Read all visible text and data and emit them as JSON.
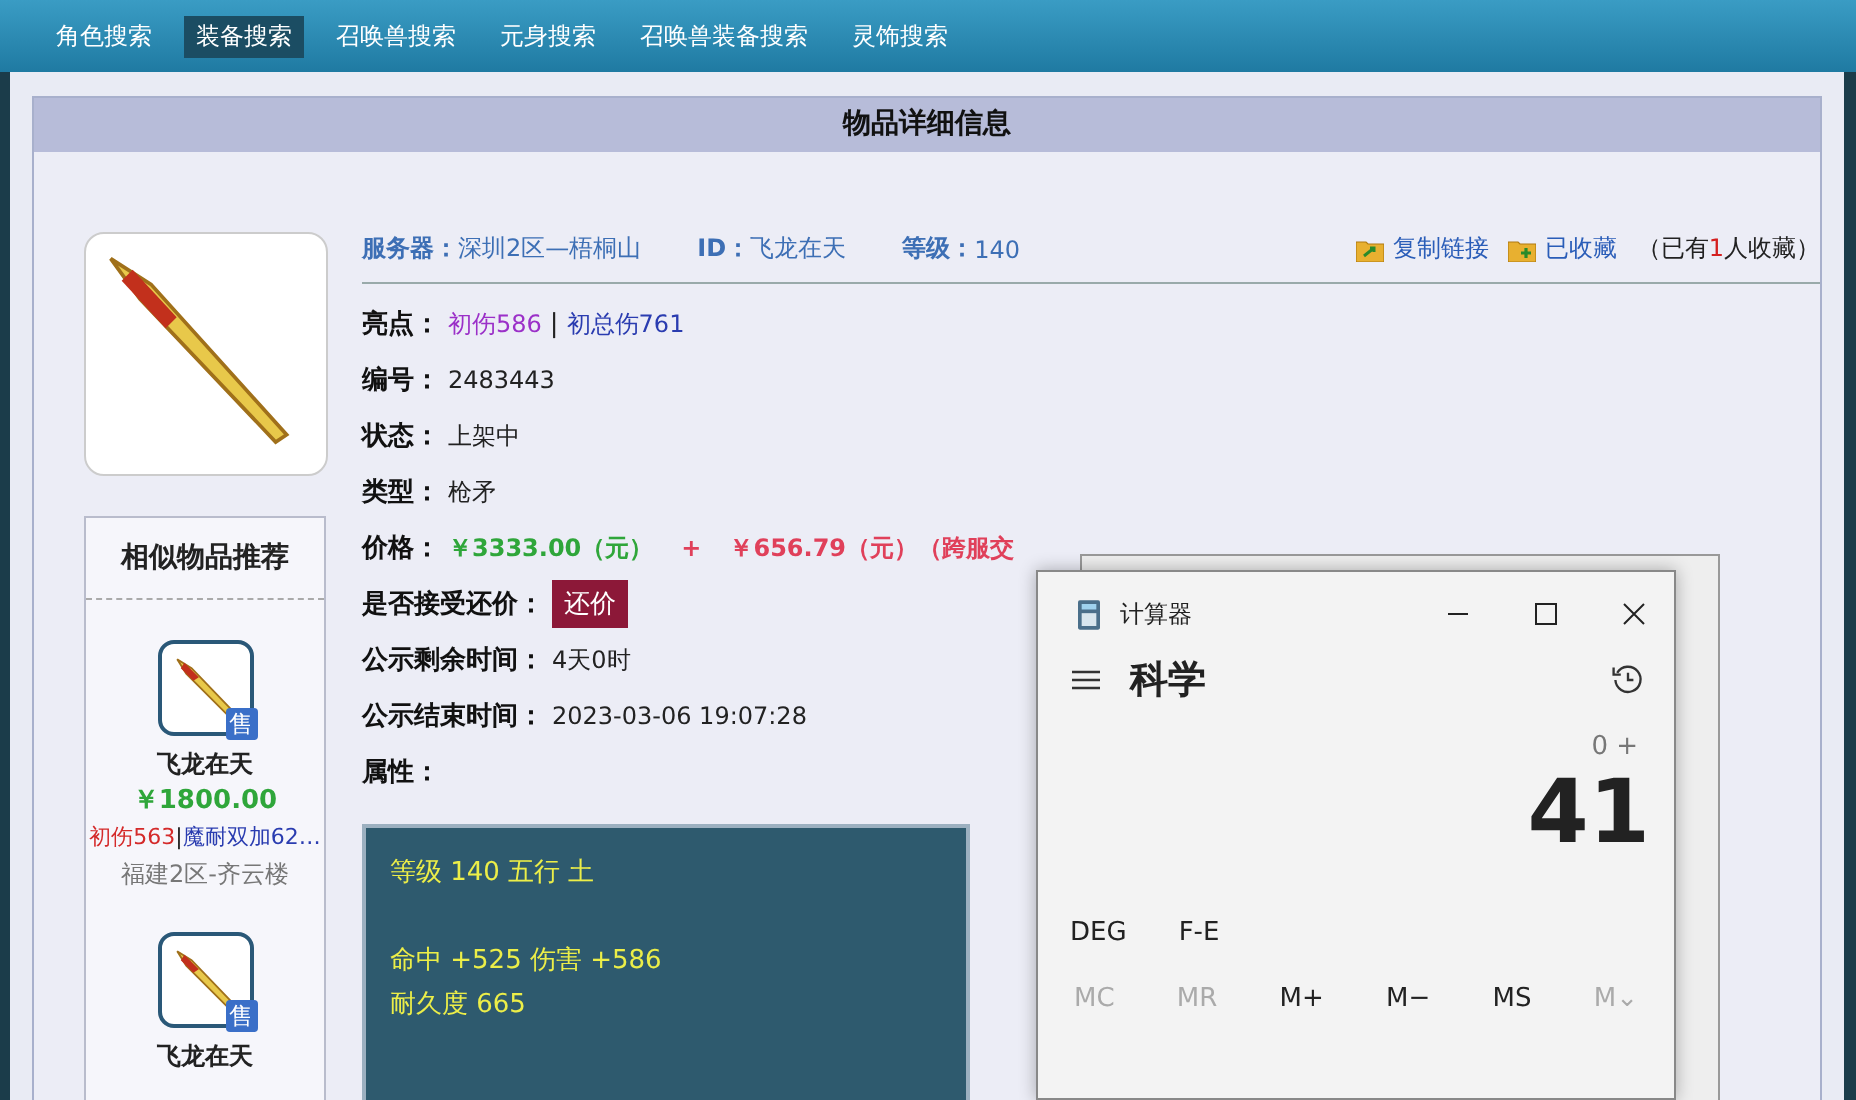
{
  "nav": [
    {
      "label": "角色搜索",
      "selected": false
    },
    {
      "label": "装备搜索",
      "selected": true
    },
    {
      "label": "召唤兽搜索",
      "selected": false
    },
    {
      "label": "元身搜索",
      "selected": false
    },
    {
      "label": "召唤兽装备搜索",
      "selected": false
    },
    {
      "label": "灵饰搜索",
      "selected": false
    }
  ],
  "panel_title": "物品详细信息",
  "summary": {
    "server_label": "服务器：",
    "server": "深圳2区—梧桐山",
    "id_label": "ID：",
    "id": "飞龙在天",
    "level_label": "等级：",
    "level": "140",
    "actions": [
      {
        "label": "复制链接",
        "kind": "copy"
      },
      {
        "label": "已收藏",
        "kind": "favorite"
      }
    ],
    "favorite_note": {
      "before": "（已有",
      "count": "1",
      "after": "人收藏）"
    }
  },
  "fields": [
    {
      "label": "亮点：",
      "kind": "tags",
      "separator": "|",
      "tags": [
        {
          "text": "初伤586",
          "color": "#9b30c8"
        },
        {
          "text": "初总伤761",
          "color": "#2a3cb0"
        }
      ]
    },
    {
      "label": "编号：",
      "kind": "text",
      "value": "2483443"
    },
    {
      "label": "状态：",
      "kind": "text",
      "value": "上架中"
    },
    {
      "label": "类型：",
      "kind": "text",
      "value": "枪矛"
    },
    {
      "label": "价格：",
      "kind": "price",
      "parts": [
        {
          "text": "￥3333.00（元）",
          "color": "#2fa63a"
        },
        {
          "text": "+",
          "color": "#e0405a"
        },
        {
          "text": "￥656.79（元）（跨服交",
          "color": "#e0405a"
        }
      ]
    },
    {
      "label": "是否接受还价：",
      "kind": "button",
      "value": "还价"
    },
    {
      "label": "公示剩余时间：",
      "kind": "text",
      "value": "4天0时"
    },
    {
      "label": "公示结束时间：",
      "kind": "text",
      "value": "2023-03-06 19:07:28"
    },
    {
      "label": "属性：",
      "kind": "text"
    }
  ],
  "attribute_groups": [
    [
      "等级 140 五行 土"
    ],
    [
      "命中 +525 伤害 +586",
      "耐久度 665"
    ]
  ],
  "recommend": {
    "title": "相似物品推荐",
    "items": [
      {
        "badge": "售",
        "name": "飞龙在天",
        "price": "￥1800.00",
        "separator": "|",
        "tags": [
          {
            "text": "初伤563",
            "color": "#d42a2a"
          },
          {
            "text": "魔耐双加62…",
            "color": "#2a3cb0"
          }
        ],
        "server": "福建2区-齐云楼"
      },
      {
        "badge": "售",
        "name": "飞龙在天"
      }
    ]
  },
  "calculator": {
    "title": "计算器",
    "mode": "科学",
    "expression": "0 +",
    "display": "41",
    "toggles": [
      "DEG",
      "F-E"
    ],
    "memory": [
      {
        "label": "MC",
        "disabled": true
      },
      {
        "label": "MR",
        "disabled": true
      },
      {
        "label": "M+",
        "disabled": false
      },
      {
        "label": "M−",
        "disabled": false
      },
      {
        "label": "MS",
        "disabled": false
      },
      {
        "label": "M⌄",
        "disabled": true
      }
    ]
  }
}
